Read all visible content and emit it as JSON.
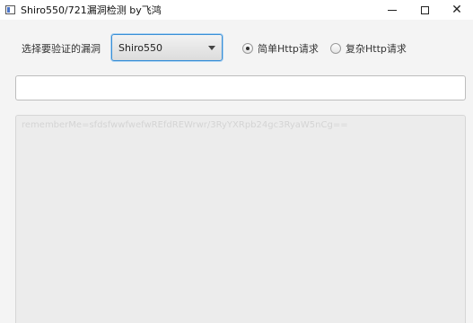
{
  "window": {
    "title": "Shiro550/721漏洞检测  by飞鸿",
    "minimize": "—",
    "maximize": "☐",
    "close": "✕"
  },
  "form": {
    "vuln_label": "选择要验证的漏洞",
    "vuln_select_value": "Shiro550",
    "radio_simple": {
      "label": "简单Http请求",
      "checked": true
    },
    "radio_complex": {
      "label": "复杂Http请求",
      "checked": false
    },
    "url_value": "",
    "output_text": "rememberMe=sfdsfwwfwefwREfdREWrwr/3RyYXRpb24gc3RyaW5nCg=="
  }
}
